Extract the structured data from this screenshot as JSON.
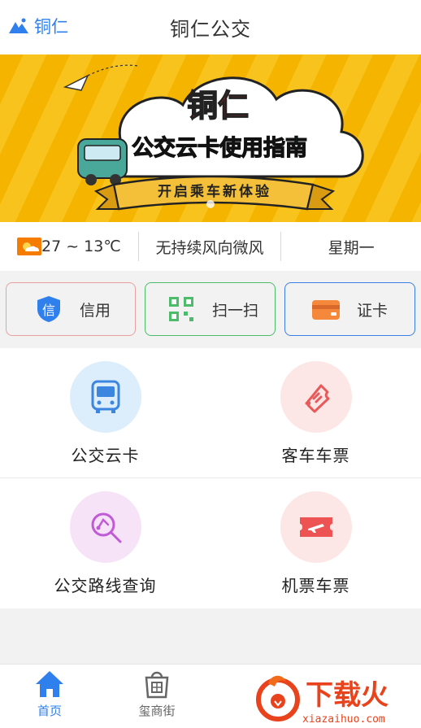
{
  "header": {
    "city": "铜仁",
    "title": "铜仁公交"
  },
  "banner": {
    "title_line1": "铜仁",
    "title_line2": "公交云卡使用指南",
    "ribbon": "开启乘车新体验"
  },
  "weather": {
    "temperature": "27 ~ 13℃",
    "wind": "无持续风向微风",
    "weekday": "星期一"
  },
  "quick_actions": [
    {
      "label": "信用",
      "icon": "shield-icon",
      "glyph": "信",
      "color": "#e8a0a0"
    },
    {
      "label": "扫一扫",
      "icon": "qr-scan-icon",
      "color": "#4cbb6a"
    },
    {
      "label": "证卡",
      "icon": "card-icon",
      "color": "#3d7ee6"
    }
  ],
  "services": [
    {
      "label": "公交云卡",
      "icon": "bus-icon"
    },
    {
      "label": "客车车票",
      "icon": "ticket-icon"
    },
    {
      "label": "公交路线查询",
      "icon": "route-search-icon"
    },
    {
      "label": "机票车票",
      "icon": "plane-ticket-icon"
    }
  ],
  "nav": [
    {
      "label": "首页",
      "icon": "home-icon",
      "active": true
    },
    {
      "label": "玺商街",
      "icon": "shop-bag-icon",
      "active": false
    }
  ],
  "watermark": {
    "text": "下载火",
    "url": "xiazaihuo.com"
  },
  "colors": {
    "accent": "#2f80ed",
    "banner_yellow": "#f5b400",
    "title_green": "#1e9e4a",
    "title_red": "#d9302b"
  }
}
